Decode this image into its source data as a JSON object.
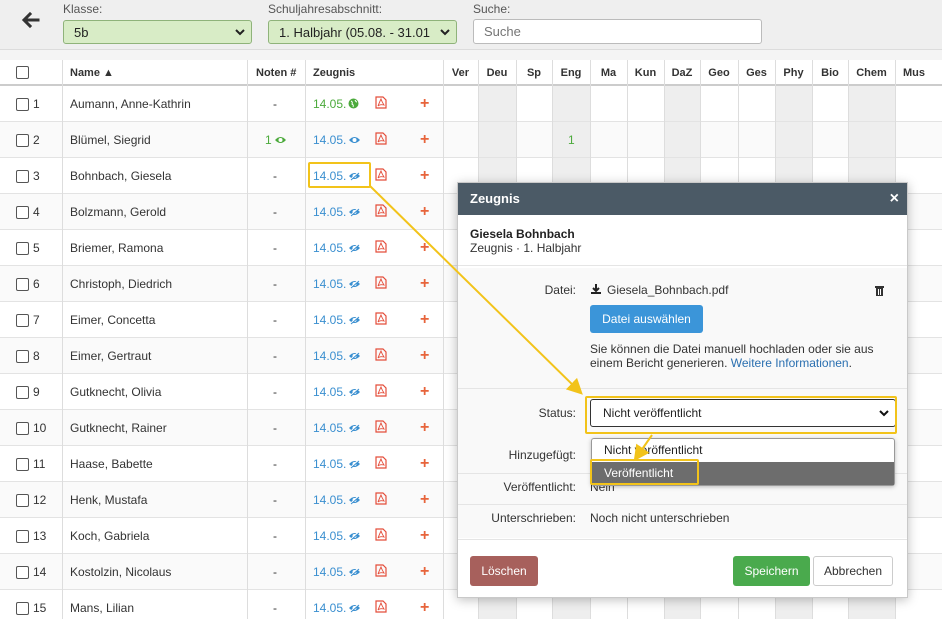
{
  "filters": {
    "klasse_label": "Klasse:",
    "klasse_value": "5b",
    "abschnitt_label": "Schuljahresabschnitt:",
    "abschnitt_value": "1. Halbjahr (05.08. - 31.01",
    "suche_label": "Suche:",
    "suche_placeholder": "Suche"
  },
  "table": {
    "headers": {
      "name": "Name ▲",
      "noten": "Noten #",
      "zeugnis": "Zeugnis",
      "subjects": [
        "Ver",
        "Deu",
        "Sp",
        "Eng",
        "Ma",
        "Kun",
        "DaZ",
        "Geo",
        "Ges",
        "Phy",
        "Bio",
        "Chem",
        "Mus"
      ]
    },
    "rows": [
      {
        "nr": "1",
        "name": "Aumann, Anne-Kathrin",
        "noten": "-",
        "date": "14.05.",
        "status_icon": "globe-icon",
        "eng": ""
      },
      {
        "nr": "2",
        "name": "Blümel, Siegrid",
        "noten": "1",
        "date": "14.05.",
        "status_icon": "eye-icon",
        "eng": "1"
      },
      {
        "nr": "3",
        "name": "Bohnbach, Giesela",
        "noten": "-",
        "date": "14.05.",
        "status_icon": "eye-slash-icon",
        "eng": ""
      },
      {
        "nr": "4",
        "name": "Bolzmann, Gerold",
        "noten": "-",
        "date": "14.05.",
        "status_icon": "eye-slash-icon",
        "eng": ""
      },
      {
        "nr": "5",
        "name": "Briemer, Ramona",
        "noten": "-",
        "date": "14.05.",
        "status_icon": "eye-slash-icon",
        "eng": ""
      },
      {
        "nr": "6",
        "name": "Christoph, Diedrich",
        "noten": "-",
        "date": "14.05.",
        "status_icon": "eye-slash-icon",
        "eng": ""
      },
      {
        "nr": "7",
        "name": "Eimer, Concetta",
        "noten": "-",
        "date": "14.05.",
        "status_icon": "eye-slash-icon",
        "eng": ""
      },
      {
        "nr": "8",
        "name": "Eimer, Gertraut",
        "noten": "-",
        "date": "14.05.",
        "status_icon": "eye-slash-icon",
        "eng": ""
      },
      {
        "nr": "9",
        "name": "Gutknecht, Olivia",
        "noten": "-",
        "date": "14.05.",
        "status_icon": "eye-slash-icon",
        "eng": ""
      },
      {
        "nr": "10",
        "name": "Gutknecht, Rainer",
        "noten": "-",
        "date": "14.05.",
        "status_icon": "eye-slash-icon",
        "eng": ""
      },
      {
        "nr": "11",
        "name": "Haase, Babette",
        "noten": "-",
        "date": "14.05.",
        "status_icon": "eye-slash-icon",
        "eng": ""
      },
      {
        "nr": "12",
        "name": "Henk, Mustafa",
        "noten": "-",
        "date": "14.05.",
        "status_icon": "eye-slash-icon",
        "eng": ""
      },
      {
        "nr": "13",
        "name": "Koch, Gabriela",
        "noten": "-",
        "date": "14.05.",
        "status_icon": "eye-slash-icon",
        "eng": ""
      },
      {
        "nr": "14",
        "name": "Kostolzin, Nicolaus",
        "noten": "-",
        "date": "14.05.",
        "status_icon": "eye-slash-icon",
        "eng": ""
      },
      {
        "nr": "15",
        "name": "Mans, Lilian",
        "noten": "-",
        "date": "14.05.",
        "status_icon": "eye-slash-icon",
        "eng": ""
      }
    ]
  },
  "modal": {
    "title": "Zeugnis",
    "close": "×",
    "student": "Giesela Bohnbach",
    "subtitle": "Zeugnis · 1. Halbjahr",
    "datei_label": "Datei:",
    "file_name": "Giesela_Bohnbach.pdf",
    "choose_file_button": "Datei auswählen",
    "info_text": "Sie können die Datei manuell hochladen oder sie aus einem Bericht generieren.",
    "info_link": "Weitere Informationen",
    "info_end": ".",
    "status_label": "Status:",
    "status_value": "Nicht veröffentlicht",
    "status_options": [
      "Nicht veröffentlicht",
      "Veröffentlicht"
    ],
    "hinzugefuegt_label": "Hinzugefügt:",
    "veroeffentlicht_label": "Veröffentlicht:",
    "veroeffentlicht_value": "Nein",
    "unterschrieben_label": "Unterschrieben:",
    "unterschrieben_value": "Noch nicht unterschrieben",
    "delete_button": "Löschen",
    "save_button": "Speichern",
    "cancel_button": "Abbrechen"
  },
  "colors": {
    "header_bg": "#4b5a66",
    "primary": "#3b95d9",
    "success": "#4aaa4d",
    "danger": "#a7605c",
    "highlight": "#f2c31a",
    "accent_plus": "#e7643b"
  }
}
